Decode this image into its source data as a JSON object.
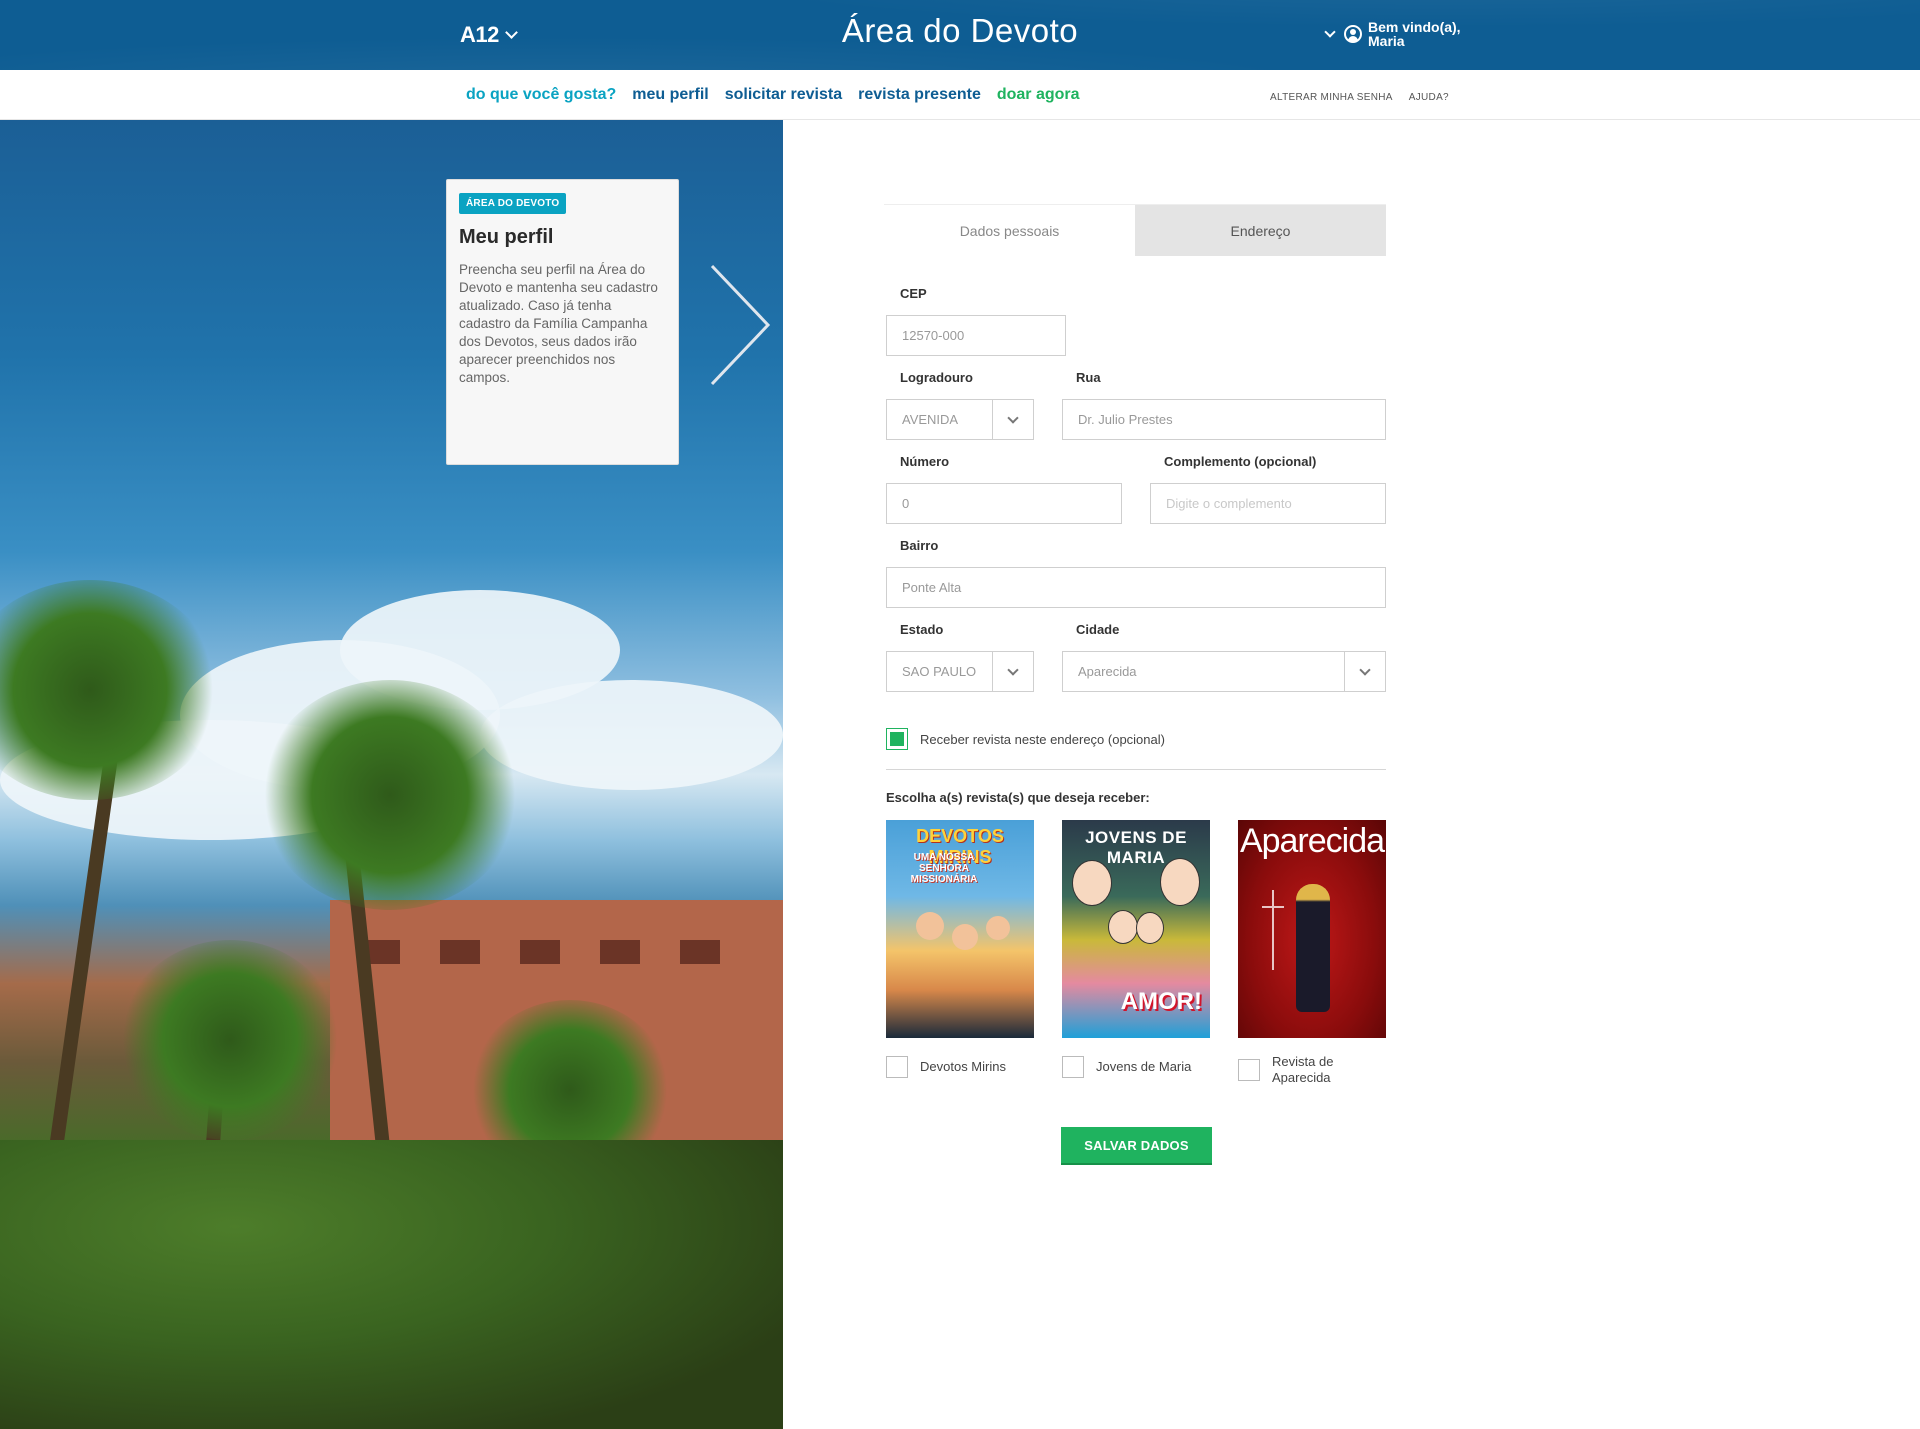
{
  "header": {
    "brand": "A12",
    "title": "Área do Devoto",
    "welcome_line1": "Bem vindo(a),",
    "welcome_line2": "Maria"
  },
  "nav": {
    "links": [
      {
        "label": "do que você gosta?"
      },
      {
        "label": "meu perfil"
      },
      {
        "label": "solicitar revista"
      },
      {
        "label": "revista presente"
      },
      {
        "label": "doar agora"
      }
    ],
    "right": [
      {
        "label": "ALTERAR MINHA SENHA"
      },
      {
        "label": "AJUDA?"
      }
    ]
  },
  "info_card": {
    "badge": "ÁREA DO DEVOTO",
    "title": "Meu perfil",
    "text": "Preencha seu perfil na Área do Devoto e mantenha seu cadastro atualizado. Caso já tenha cadastro da Família Campanha dos Devotos, seus dados irão aparecer preenchidos nos campos."
  },
  "tabs": [
    {
      "label": "Dados pessoais",
      "active": false
    },
    {
      "label": "Endereço",
      "active": true
    }
  ],
  "form": {
    "cep": {
      "label": "CEP",
      "value": "12570-000"
    },
    "logradouro": {
      "label": "Logradouro",
      "value": "AVENIDA"
    },
    "rua": {
      "label": "Rua",
      "value": "Dr. Julio Prestes"
    },
    "numero": {
      "label": "Número",
      "value": "0"
    },
    "complemento": {
      "label": "Complemento (opcional)",
      "placeholder": "Digite o complemento"
    },
    "bairro": {
      "label": "Bairro",
      "value": "Ponte Alta"
    },
    "estado": {
      "label": "Estado",
      "value": "SAO PAULO"
    },
    "cidade": {
      "label": "Cidade",
      "value": "Aparecida"
    },
    "receber": {
      "label": "Receber revista neste endereço (opcional)",
      "checked": true
    }
  },
  "magazines": {
    "prompt": "Escolha a(s) revista(s) que deseja receber:",
    "items": [
      {
        "cover_title": "DEVOTOS MIRINS",
        "cover_sub": "UMA NOSSA SENHORA MISSIONÁRIA",
        "label": "Devotos Mirins",
        "checked": false
      },
      {
        "cover_title": "JOVENS DE MARIA",
        "cover_sub": "AMOR!",
        "label": "Jovens de Maria",
        "checked": false
      },
      {
        "cover_title": "Aparecida",
        "label_line1": "Revista de",
        "label_line2": "Aparecida",
        "checked": false
      }
    ]
  },
  "save_label": "SALVAR DADOS",
  "colors": {
    "header_bg": "#0e5d93",
    "nav_teal": "#0aa3c2",
    "nav_green": "#1fb35f",
    "primary_button": "#1fb35f",
    "tab_active_bg": "#e4e4e4"
  },
  "icons": {
    "brand_chevron": "chevron-down-icon",
    "user": "user-circle-icon",
    "next": "chevron-right-icon",
    "select": "chevron-down-icon"
  }
}
